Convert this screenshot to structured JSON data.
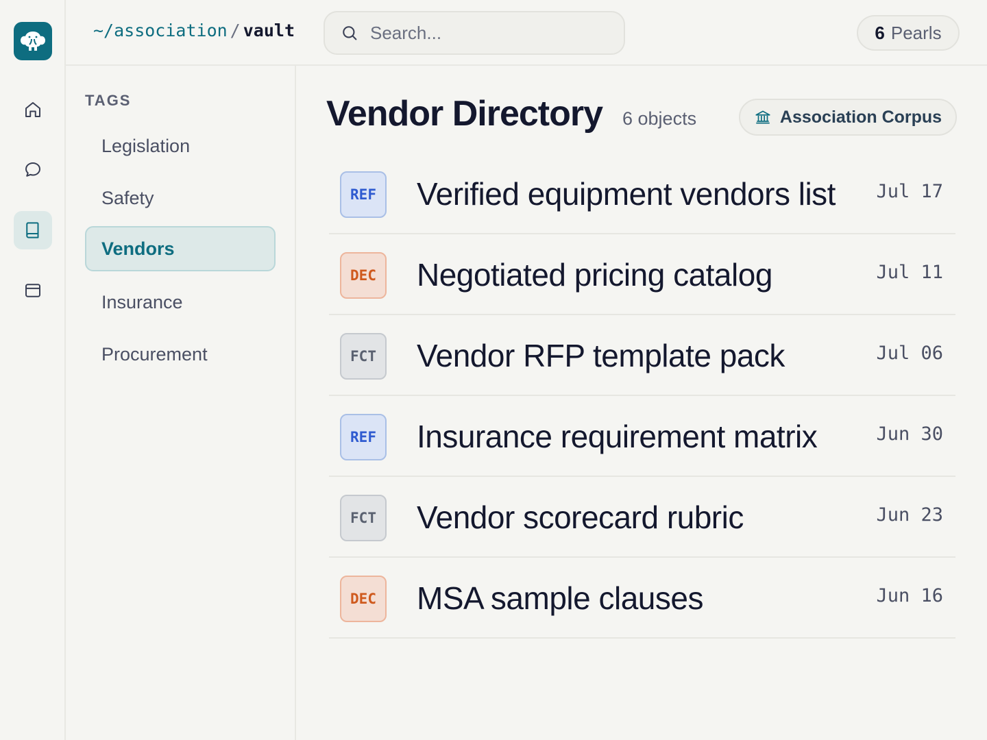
{
  "app": {
    "logo_icon": "elephant-icon",
    "accent_color": "#0e6d80"
  },
  "rail": {
    "items": [
      {
        "icon": "home-icon",
        "active": false
      },
      {
        "icon": "chat-icon",
        "active": false
      },
      {
        "icon": "book-icon",
        "active": true
      },
      {
        "icon": "calendar-icon",
        "active": false
      }
    ]
  },
  "header": {
    "breadcrumb": {
      "root": "~/association",
      "separator": "/",
      "current": "vault"
    },
    "search": {
      "placeholder": "Search..."
    },
    "pearls": {
      "count": "6",
      "label": "Pearls"
    }
  },
  "tags": {
    "heading": "TAGS",
    "items": [
      {
        "label": "Legislation",
        "active": false
      },
      {
        "label": "Safety",
        "active": false
      },
      {
        "label": "Vendors",
        "active": true
      },
      {
        "label": "Insurance",
        "active": false
      },
      {
        "label": "Procurement",
        "active": false
      }
    ]
  },
  "main": {
    "title": "Vendor Directory",
    "object_count": "6 objects",
    "corpus": {
      "icon": "building-columns-icon",
      "label": "Association Corpus"
    },
    "documents": [
      {
        "type": "REF",
        "title": "Verified equipment vendors list",
        "date": "Jul 17"
      },
      {
        "type": "DEC",
        "title": "Negotiated pricing catalog",
        "date": "Jul 11"
      },
      {
        "type": "FCT",
        "title": "Vendor RFP template pack",
        "date": "Jul 06"
      },
      {
        "type": "REF",
        "title": "Insurance requirement matrix",
        "date": "Jun 30"
      },
      {
        "type": "FCT",
        "title": "Vendor scorecard rubric",
        "date": "Jun 23"
      },
      {
        "type": "DEC",
        "title": "MSA sample clauses",
        "date": "Jun 16"
      }
    ]
  }
}
